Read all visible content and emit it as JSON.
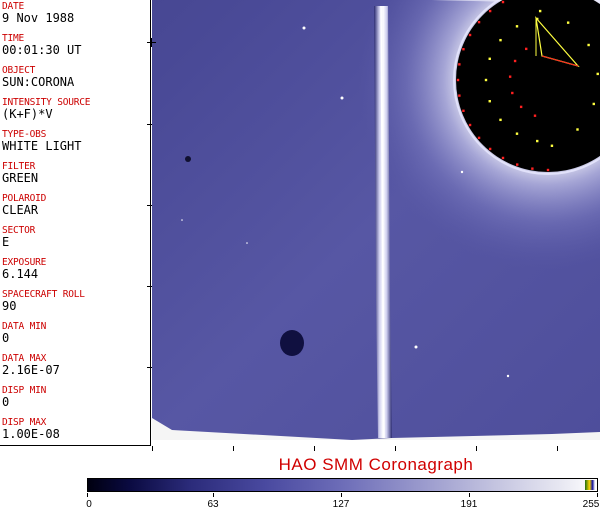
{
  "metadata": [
    {
      "label": "DATE",
      "value": "9 Nov 1988"
    },
    {
      "label": "TIME",
      "value": "00:01:30 UT"
    },
    {
      "label": "OBJECT",
      "value": "SUN:CORONA"
    },
    {
      "label": "INTENSITY SOURCE",
      "value": "(K+F)*V"
    },
    {
      "label": "TYPE-OBS",
      "value": "WHITE LIGHT"
    },
    {
      "label": "FILTER",
      "value": "GREEN"
    },
    {
      "label": "POLAROID",
      "value": "CLEAR"
    },
    {
      "label": "SECTOR",
      "value": "E"
    },
    {
      "label": "EXPOSURE",
      "value": "6.144"
    },
    {
      "label": "SPACECRAFT ROLL",
      "value": "90"
    },
    {
      "label": "DATA MIN",
      "value": "0"
    },
    {
      "label": "DATA MAX",
      "value": "2.16E-07"
    },
    {
      "label": "DISP MIN",
      "value": "0"
    },
    {
      "label": "DISP MAX",
      "value": "1.00E-08"
    }
  ],
  "title": "HAO  SMM Coronagraph",
  "colorbar": {
    "ticks": [
      "0",
      "63",
      "127",
      "191",
      "255"
    ],
    "colors": {
      "dark": "#000010",
      "mid": "#6d6db8",
      "light": "#ffffff"
    }
  },
  "image": {
    "corona_color": "#5a5aa8",
    "occulter_color": "#000000",
    "marker_colors": {
      "red": "#ff2020",
      "yellow": "#ffff40"
    }
  }
}
